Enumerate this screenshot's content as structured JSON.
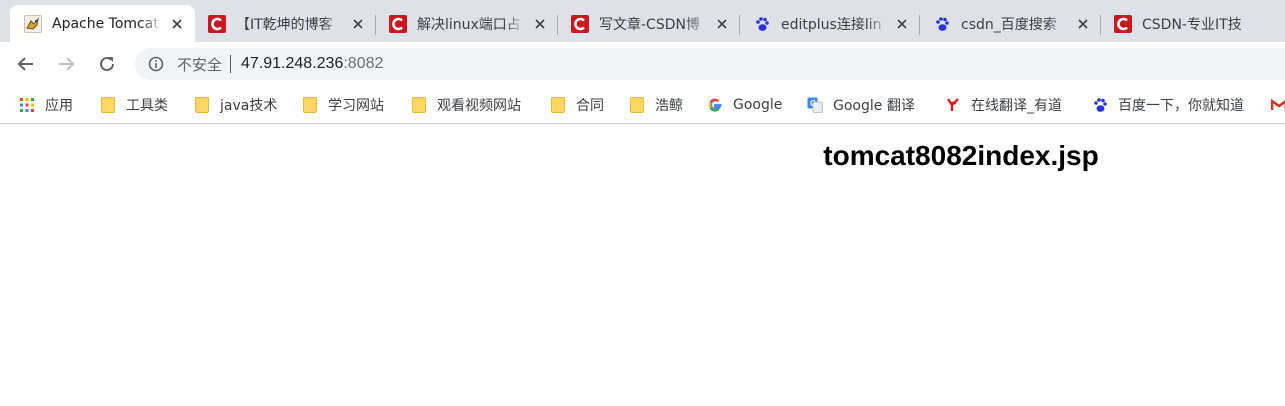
{
  "tabs": [
    {
      "title": "Apache Tomcat",
      "favicon": "tomcat-cat-icon",
      "active": true
    },
    {
      "title": "【IT乾坤的博客",
      "favicon": "csdn-logo-icon",
      "active": false
    },
    {
      "title": "解决linux端口占",
      "favicon": "csdn-logo-icon",
      "active": false
    },
    {
      "title": "写文章-CSDN博",
      "favicon": "csdn-logo-icon",
      "active": false
    },
    {
      "title": "editplus连接lin",
      "favicon": "baidu-paw-icon",
      "active": false
    },
    {
      "title": "csdn_百度搜索",
      "favicon": "baidu-paw-icon",
      "active": false
    },
    {
      "title": "CSDN-专业IT技",
      "favicon": "csdn-logo-icon",
      "active": false
    }
  ],
  "toolbar": {
    "back": "back-arrow-icon",
    "forward": "forward-arrow-icon",
    "reload": "reload-icon"
  },
  "omnibox": {
    "security_label": "不安全",
    "url_host": "47.91.248.236",
    "url_port": ":8082"
  },
  "bookmarks": [
    {
      "label": "应用",
      "icon": "apps-grid-icon"
    },
    {
      "label": "工具类",
      "icon": "folder-icon"
    },
    {
      "label": "java技术",
      "icon": "folder-icon"
    },
    {
      "label": "学习网站",
      "icon": "folder-icon"
    },
    {
      "label": "观看视频网站",
      "icon": "folder-icon"
    },
    {
      "label": "合同",
      "icon": "folder-icon"
    },
    {
      "label": "浩鲸",
      "icon": "folder-icon"
    },
    {
      "label": "Google",
      "icon": "google-g-icon"
    },
    {
      "label": "Google 翻译",
      "icon": "google-translate-icon"
    },
    {
      "label": "在线翻译_有道",
      "icon": "youdao-icon"
    },
    {
      "label": "百度一下，你就知道",
      "icon": "baidu-paw-icon"
    }
  ],
  "page": {
    "heading": "tomcat8082index.jsp"
  },
  "colors": {
    "tabstrip": "#dee1e6",
    "csdn_red": "#c9181e",
    "baidu_blue": "#2932e1",
    "folder_yellow": "#fdd663"
  }
}
